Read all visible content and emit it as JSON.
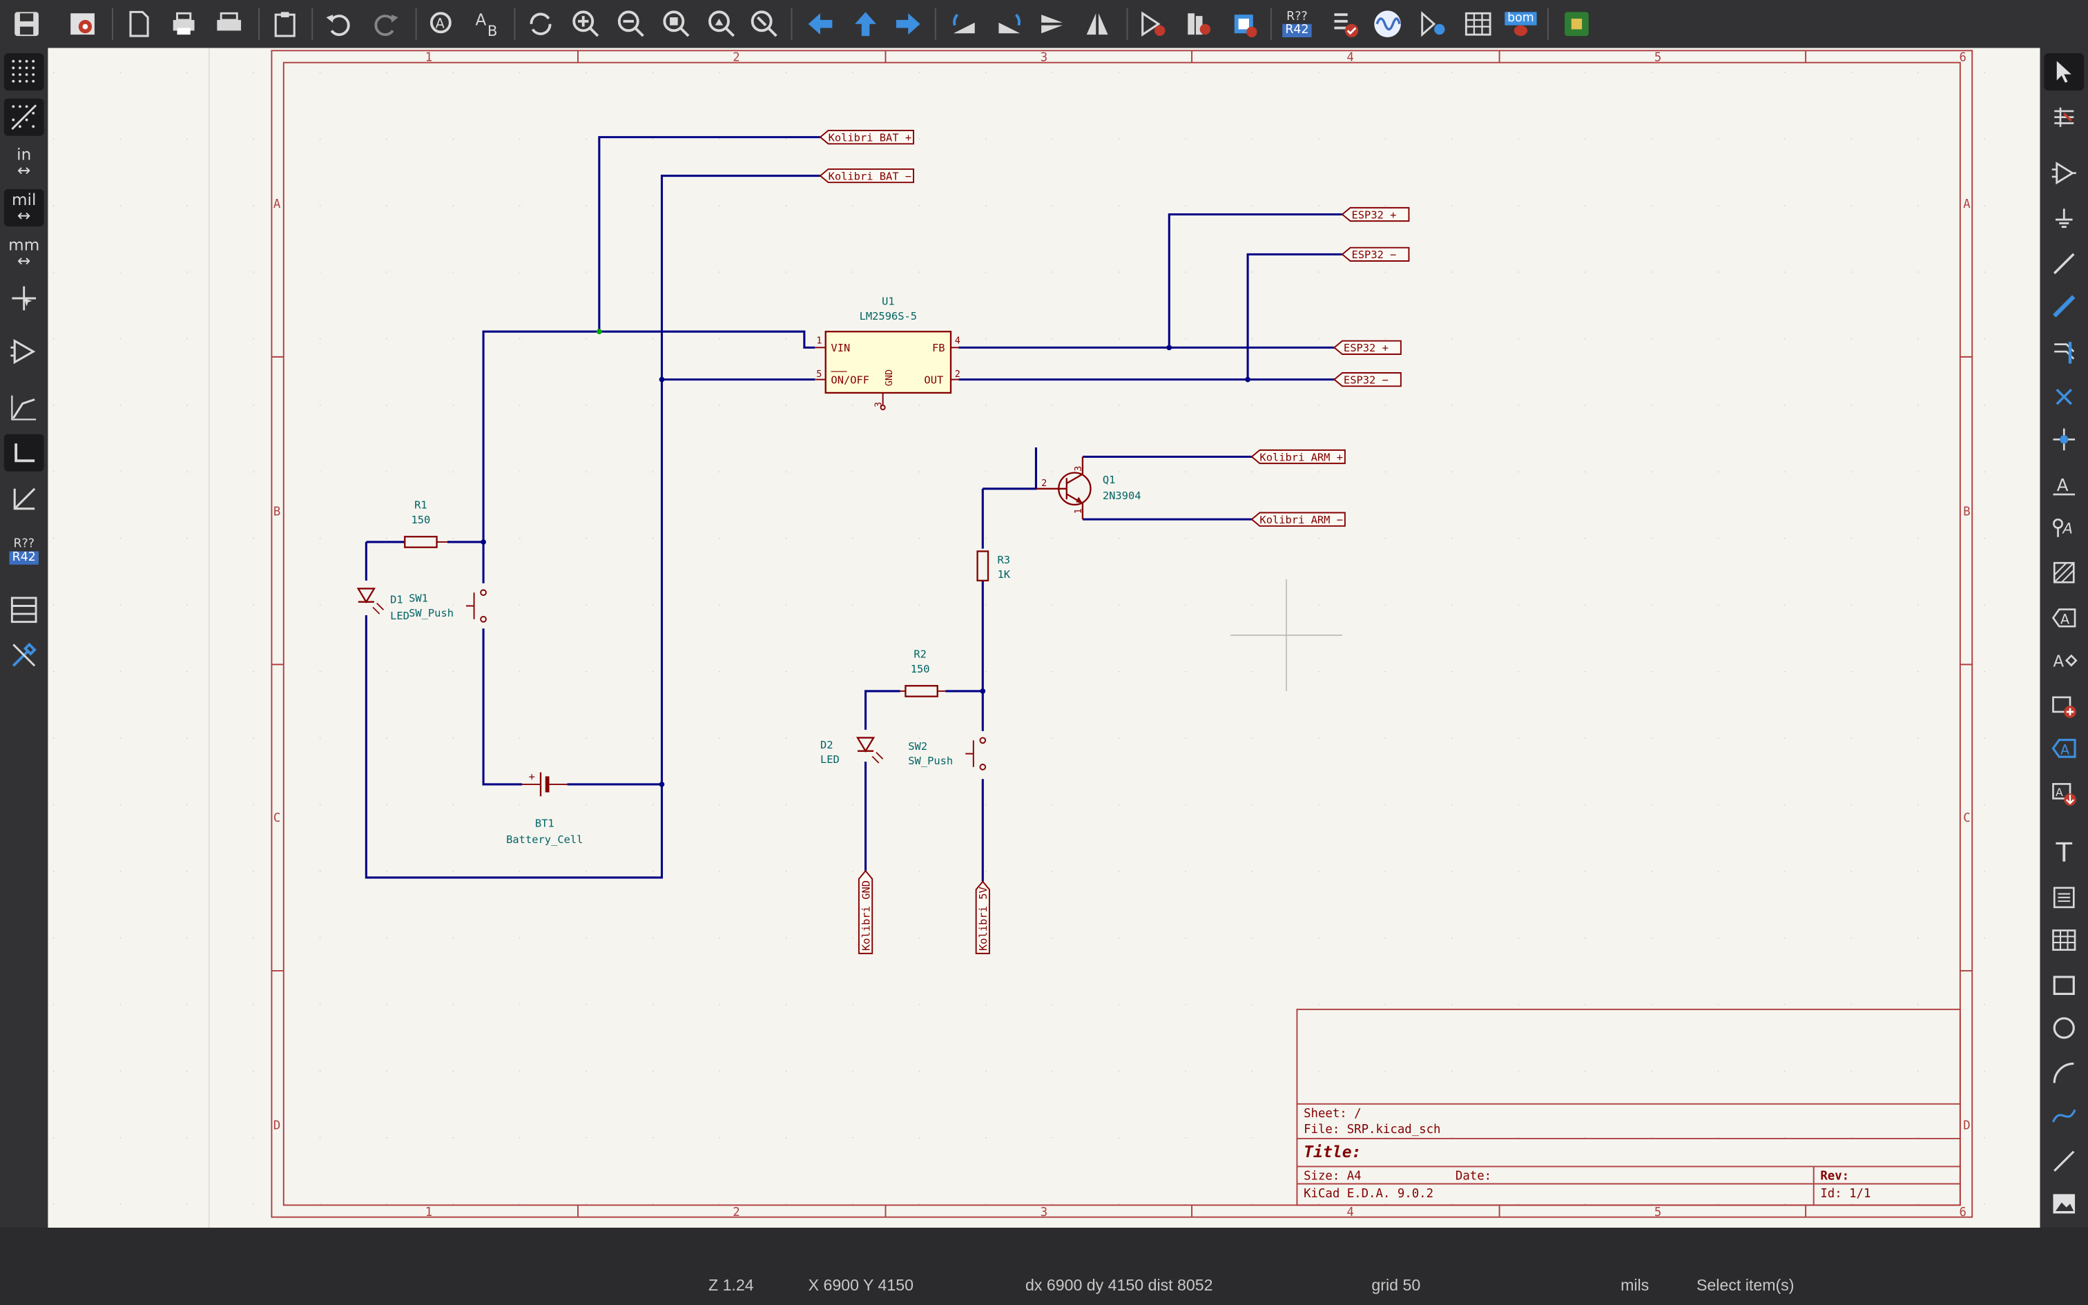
{
  "colors": {
    "wire": "#000084",
    "border": "#b04040",
    "component": "#840000",
    "label_text": "#006464",
    "canvas_bg": "#f5f4ef",
    "junction": "#00aa00"
  },
  "toolbar": {
    "top_icons": [
      "save-icon",
      "schematic-setup-icon",
      "page-settings-icon",
      "print-icon",
      "plot-icon",
      "paste-icon",
      "undo-icon",
      "redo-icon",
      "find-icon",
      "find-replace-icon",
      "refresh-icon",
      "zoom-in-icon",
      "zoom-out-icon",
      "zoom-fit-icon",
      "zoom-objects-icon",
      "zoom-selection-icon",
      "navigate-back-icon",
      "navigate-up-icon",
      "navigate-forward-icon",
      "rotate-ccw-icon",
      "rotate-cw-icon",
      "mirror-v-icon",
      "mirror-h-icon",
      "symbol-editor-icon",
      "symbol-library-icon",
      "footprint-assign-icon",
      "annotate-icon",
      "erc-icon",
      "simulator-icon",
      "netlist-icon",
      "bom-table-icon",
      "bom-generate-icon",
      "pcb-editor-icon"
    ],
    "annotate_label_top": "R??",
    "annotate_label_bottom": "R42",
    "bom_label": "bom"
  },
  "left_toolbar": {
    "units_in": "in",
    "units_mil": "mil",
    "units_mm": "mm",
    "annotate_top": "R??",
    "annotate_bottom": "R42"
  },
  "right_toolbar": {
    "text_icon_label": "T"
  },
  "frame": {
    "col_numbers": [
      "1",
      "2",
      "3",
      "4",
      "5",
      "6"
    ],
    "row_letters": [
      "A",
      "B",
      "C",
      "D"
    ]
  },
  "schematic": {
    "labels": {
      "kolibri_bat_plus": "Kolibri BAT +",
      "kolibri_bat_minus": "Kolibri BAT −",
      "esp32_plus_a": "ESP32 +",
      "esp32_minus_a": "ESP32 −",
      "esp32_plus_b": "ESP32 +",
      "esp32_minus_b": "ESP32 −",
      "kolibri_arm_plus": "Kolibri ARM +",
      "kolibri_arm_minus": "Kolibri ARM −",
      "kolibri_gnd": "Kolibri GND",
      "kolibri_5v": "Kolibri 5V"
    },
    "u1": {
      "ref": "U1",
      "value": "LM2596S-5",
      "pin_vin": "VIN",
      "pin_onoff": "ON/OFF",
      "pin_gnd": "GND",
      "pin_fb": "FB",
      "pin_out": "OUT",
      "pin1": "1",
      "pin5": "5",
      "pin3": "3",
      "pin4": "4",
      "pin2": "2"
    },
    "q1": {
      "ref": "Q1",
      "value": "2N3904",
      "pin2": "2",
      "pin3": "3",
      "pin1": "1"
    },
    "r1": {
      "ref": "R1",
      "value": "150"
    },
    "r2": {
      "ref": "R2",
      "value": "150"
    },
    "r3": {
      "ref": "R3",
      "value": "1K"
    },
    "d1": {
      "ref": "D1",
      "value": "LED"
    },
    "d2": {
      "ref": "D2",
      "value": "LED"
    },
    "sw1": {
      "ref": "SW1",
      "value": "SW_Push"
    },
    "sw2": {
      "ref": "SW2",
      "value": "SW_Push"
    },
    "bt1": {
      "ref": "BT1",
      "value": "Battery_Cell"
    }
  },
  "title_block": {
    "sheet": "Sheet: /",
    "file": "File: SRP.kicad_sch",
    "title": "Title:",
    "size": "Size: A4",
    "date": "Date:",
    "rev": "Rev:",
    "tool": "KiCad E.D.A. 9.0.2",
    "id": "Id: 1/1"
  },
  "status": {
    "zoom": "Z 1.24",
    "xy": "X 6900  Y 4150",
    "delta": "dx 6900  dy 4150  dist 8052",
    "grid": "grid 50",
    "units": "mils",
    "mode": "Select item(s)"
  }
}
